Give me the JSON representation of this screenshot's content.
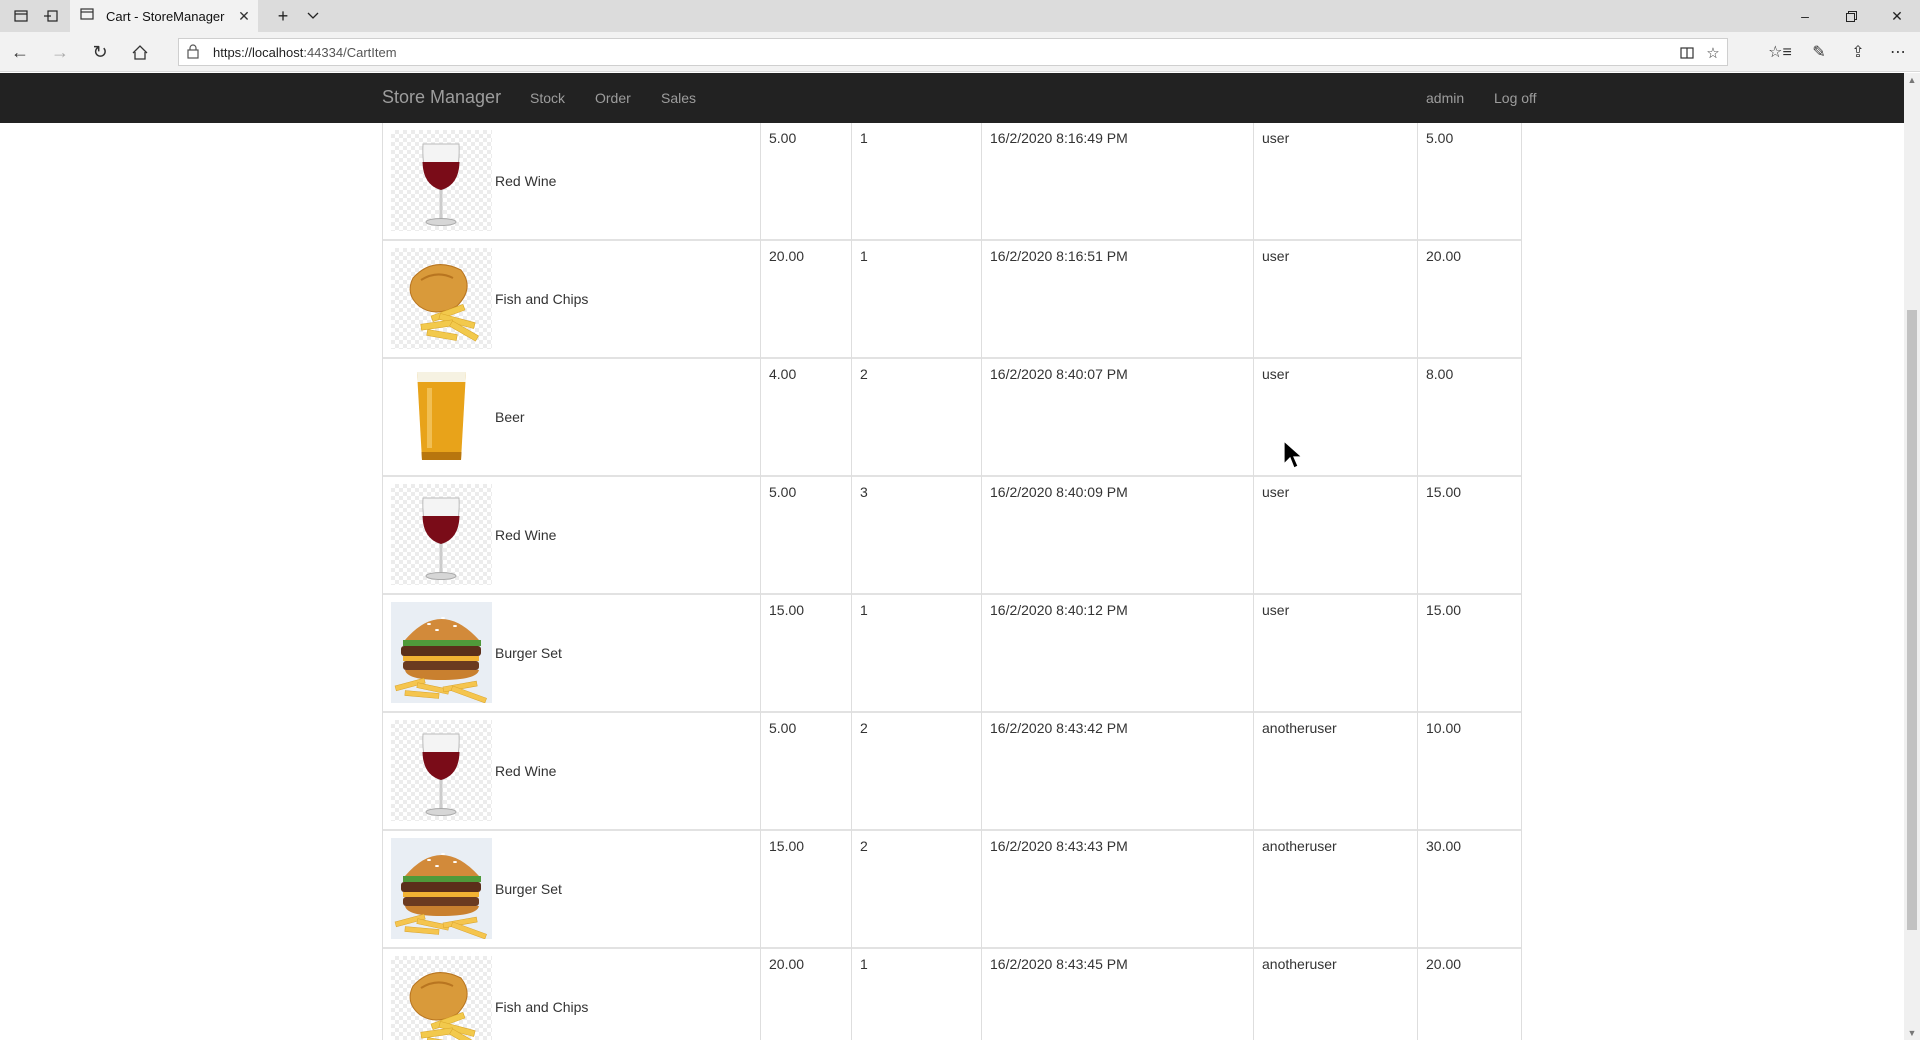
{
  "browser": {
    "tab_title": "Cart - StoreManager",
    "url_host": "https://localhost",
    "url_rest": ":44334/CartItem"
  },
  "nav": {
    "brand": "Store Manager",
    "links": [
      "Stock",
      "Order",
      "Sales"
    ],
    "user": "admin",
    "logoff": "Log off"
  },
  "rows": [
    {
      "name": "Red Wine",
      "image": "wine-glass-icon",
      "price": "5.00",
      "qty": "1",
      "date": "16/2/2020 8:16:49 PM",
      "user": "user",
      "total": "5.00"
    },
    {
      "name": "Fish and Chips",
      "image": "fish-and-chips-icon",
      "price": "20.00",
      "qty": "1",
      "date": "16/2/2020 8:16:51 PM",
      "user": "user",
      "total": "20.00"
    },
    {
      "name": "Beer",
      "image": "beer-glass-icon",
      "price": "4.00",
      "qty": "2",
      "date": "16/2/2020 8:40:07 PM",
      "user": "user",
      "total": "8.00"
    },
    {
      "name": "Red Wine",
      "image": "wine-glass-icon",
      "price": "5.00",
      "qty": "3",
      "date": "16/2/2020 8:40:09 PM",
      "user": "user",
      "total": "15.00"
    },
    {
      "name": "Burger Set",
      "image": "burger-set-icon",
      "price": "15.00",
      "qty": "1",
      "date": "16/2/2020 8:40:12 PM",
      "user": "user",
      "total": "15.00"
    },
    {
      "name": "Red Wine",
      "image": "wine-glass-icon",
      "price": "5.00",
      "qty": "2",
      "date": "16/2/2020 8:43:42 PM",
      "user": "anotheruser",
      "total": "10.00"
    },
    {
      "name": "Burger Set",
      "image": "burger-set-icon",
      "price": "15.00",
      "qty": "2",
      "date": "16/2/2020 8:43:43 PM",
      "user": "anotheruser",
      "total": "30.00"
    },
    {
      "name": "Fish and Chips",
      "image": "fish-and-chips-icon",
      "price": "20.00",
      "qty": "1",
      "date": "16/2/2020 8:43:45 PM",
      "user": "anotheruser",
      "total": "20.00"
    }
  ],
  "colors": {
    "navbar_bg": "#222222",
    "navbar_text": "#9d9d9d",
    "wine": "#7a0c18",
    "beer": "#e8a31a"
  }
}
